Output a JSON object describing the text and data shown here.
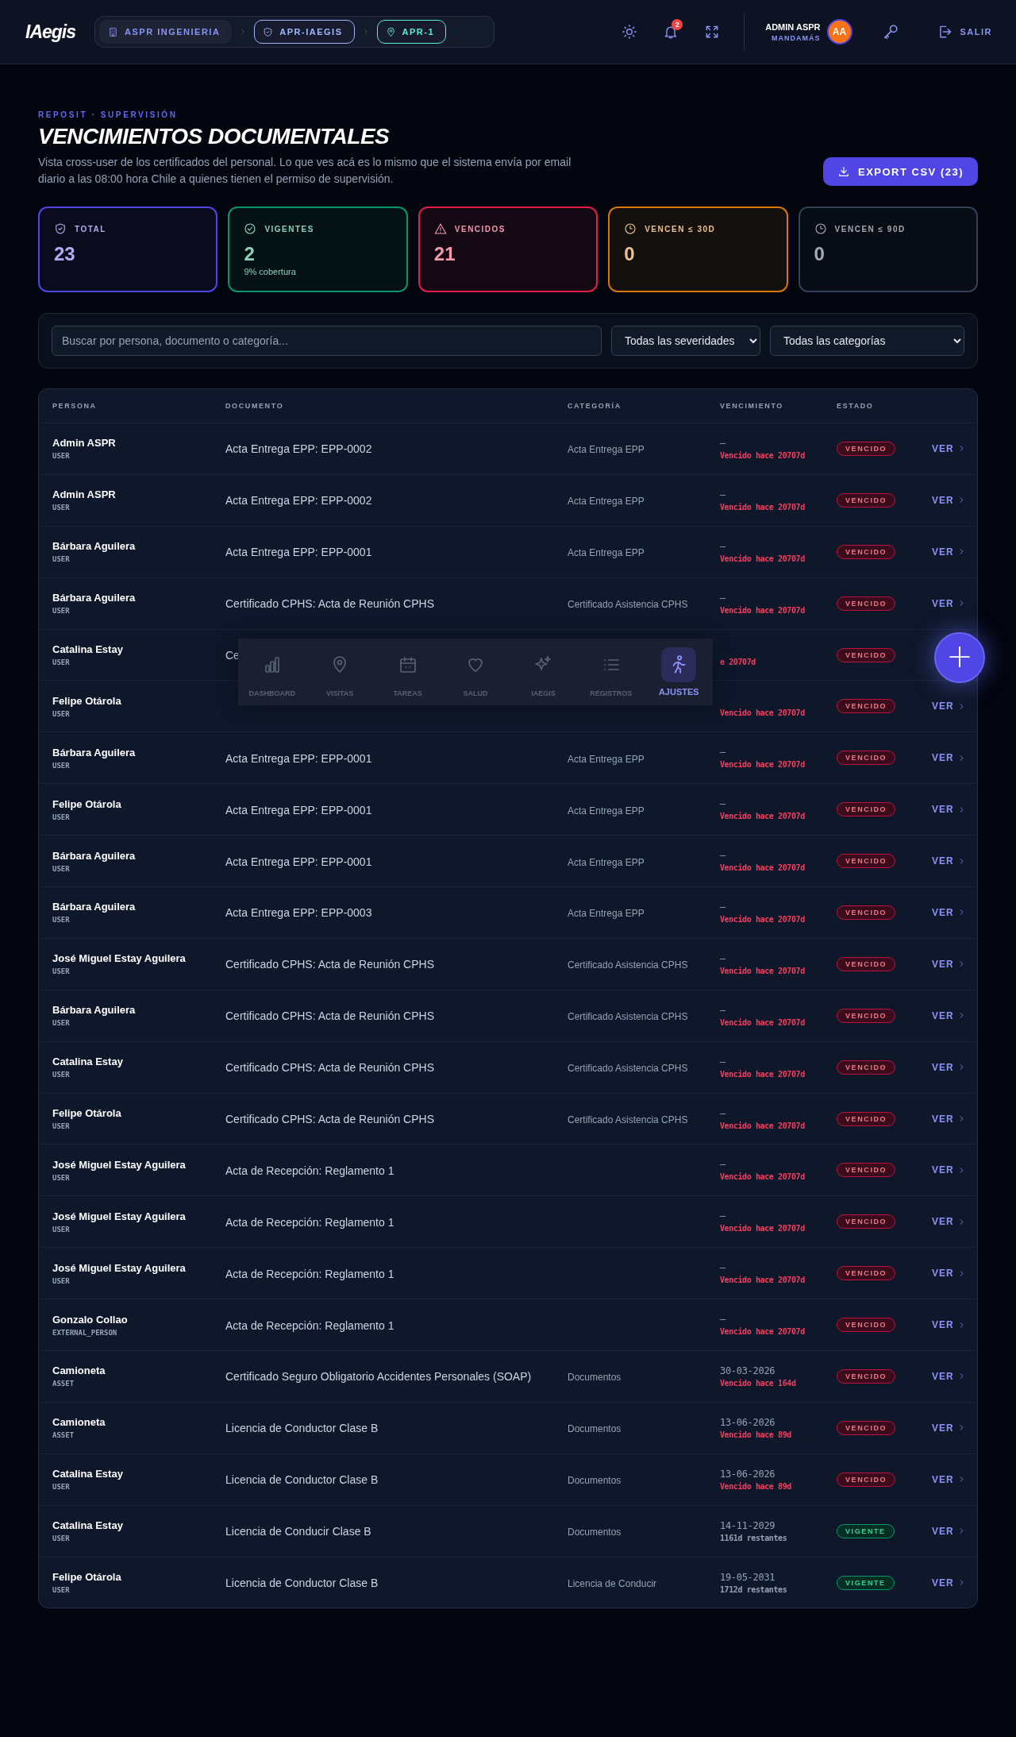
{
  "header": {
    "logo": "IAegis",
    "breadcrumbs": [
      {
        "label": "ASPR INGENIERIA",
        "color": "#1e2433"
      },
      {
        "label": "APR-IAEGIS",
        "color": "#a5b4fc"
      },
      {
        "label": "APR-1",
        "color": "#5eead4"
      }
    ],
    "notifications": "2",
    "user_name": "ADMIN ASPR",
    "user_role": "MANDAMÁS",
    "avatar": "AA",
    "logout": "SALIR"
  },
  "intro": {
    "eyebrow": "REPOSIT · SUPERVISIÓN",
    "title": "VENCIMIENTOS DOCUMENTALES",
    "description": "Vista cross-user de los certificados del personal. Lo que ves acá es lo mismo que el sistema envía por email diario a las 08:00 hora Chile a quienes tienen el permiso de supervisión.",
    "export_button": "EXPORT CSV (23)"
  },
  "stats": [
    {
      "label": "TOTAL",
      "value": "23",
      "color": "#4f46e5"
    },
    {
      "label": "VIGENTES",
      "value": "2",
      "sub": "9% cobertura",
      "color": "#059669"
    },
    {
      "label": "VENCIDOS",
      "value": "21",
      "color": "#e11d48"
    },
    {
      "label": "VENCEN ≤ 30D",
      "value": "0",
      "color": "#d97706"
    },
    {
      "label": "VENCEN ≤ 90D",
      "value": "0",
      "color": "#334155"
    }
  ],
  "filters": {
    "search": {
      "placeholder": "Buscar por persona, documento o categoría..."
    },
    "severity": "Todas las severidades",
    "category": "Todas las categorías"
  },
  "table": {
    "columns": [
      "PERSONA",
      "DOCUMENTO",
      "CATEGORÍA",
      "VENCIMIENTO",
      "ESTADO"
    ],
    "rows": [
      {
        "name": "Admin ASPR",
        "role": "USER",
        "document": "Acta Entrega EPP: EPP-0002",
        "category": "Acta Entrega EPP",
        "due": "—",
        "note": "Vencido hace 20707d",
        "status": "VENCIDO",
        "kind": "expired",
        "action": "VER"
      },
      {
        "name": "Admin ASPR",
        "role": "USER",
        "document": "Acta Entrega EPP: EPP-0002",
        "category": "Acta Entrega EPP",
        "due": "—",
        "note": "Vencido hace 20707d",
        "status": "VENCIDO",
        "kind": "expired",
        "action": "VER"
      },
      {
        "name": "Bárbara Aguilera",
        "role": "USER",
        "document": "Acta Entrega EPP: EPP-0001",
        "category": "Acta Entrega EPP",
        "due": "—",
        "note": "Vencido hace 20707d",
        "status": "VENCIDO",
        "kind": "expired",
        "action": "VER"
      },
      {
        "name": "Bárbara Aguilera",
        "role": "USER",
        "document": "Certificado CPHS: Acta de Reunión CPHS",
        "category": "Certificado Asistencia CPHS",
        "due": "—",
        "note": "Vencido hace 20707d",
        "status": "VENCIDO",
        "kind": "expired",
        "action": "VER"
      },
      {
        "name": "Catalina Estay",
        "role": "USER",
        "document": "Ce",
        "note": "e 20707d",
        "status": "VENCIDO",
        "kind": "expired"
      },
      {
        "name": "Felipe Otárola",
        "role": "USER",
        "note": "Vencido hace 20707d",
        "status": "VENCIDO",
        "kind": "expired",
        "action": "VER"
      },
      {
        "name": "Bárbara Aguilera",
        "role": "USER",
        "document": "Acta Entrega EPP: EPP-0001",
        "category": "Acta Entrega EPP",
        "due": "—",
        "note": "Vencido hace 20707d",
        "status": "VENCIDO",
        "kind": "expired",
        "action": "VER"
      },
      {
        "name": "Felipe Otárola",
        "role": "USER",
        "document": "Acta Entrega EPP: EPP-0001",
        "category": "Acta Entrega EPP",
        "due": "—",
        "note": "Vencido hace 20707d",
        "status": "VENCIDO",
        "kind": "expired",
        "action": "VER"
      },
      {
        "name": "Bárbara Aguilera",
        "role": "USER",
        "document": "Acta Entrega EPP: EPP-0001",
        "category": "Acta Entrega EPP",
        "due": "—",
        "note": "Vencido hace 20707d",
        "status": "VENCIDO",
        "kind": "expired",
        "action": "VER"
      },
      {
        "name": "Bárbara Aguilera",
        "role": "USER",
        "document": "Acta Entrega EPP: EPP-0003",
        "category": "Acta Entrega EPP",
        "due": "—",
        "note": "Vencido hace 20707d",
        "status": "VENCIDO",
        "kind": "expired",
        "action": "VER"
      },
      {
        "name": "José Miguel Estay Aguilera",
        "role": "USER",
        "document": "Certificado CPHS: Acta de Reunión CPHS",
        "category": "Certificado Asistencia CPHS",
        "due": "—",
        "note": "Vencido hace 20707d",
        "status": "VENCIDO",
        "kind": "expired",
        "action": "VER"
      },
      {
        "name": "Bárbara Aguilera",
        "role": "USER",
        "document": "Certificado CPHS: Acta de Reunión CPHS",
        "category": "Certificado Asistencia CPHS",
        "due": "—",
        "note": "Vencido hace 20707d",
        "status": "VENCIDO",
        "kind": "expired",
        "action": "VER"
      },
      {
        "name": "Catalina Estay",
        "role": "USER",
        "document": "Certificado CPHS: Acta de Reunión CPHS",
        "category": "Certificado Asistencia CPHS",
        "due": "—",
        "note": "Vencido hace 20707d",
        "status": "VENCIDO",
        "kind": "expired",
        "action": "VER"
      },
      {
        "name": "Felipe Otárola",
        "role": "USER",
        "document": "Certificado CPHS: Acta de Reunión CPHS",
        "category": "Certificado Asistencia CPHS",
        "due": "—",
        "note": "Vencido hace 20707d",
        "status": "VENCIDO",
        "kind": "expired",
        "action": "VER"
      },
      {
        "name": "José Miguel Estay Aguilera",
        "role": "USER",
        "document": "Acta de Recepción: Reglamento 1",
        "due": "—",
        "note": "Vencido hace 20707d",
        "status": "VENCIDO",
        "kind": "expired",
        "action": "VER"
      },
      {
        "name": "José Miguel Estay Aguilera",
        "role": "USER",
        "document": "Acta de Recepción: Reglamento 1",
        "due": "—",
        "note": "Vencido hace 20707d",
        "status": "VENCIDO",
        "kind": "expired",
        "action": "VER"
      },
      {
        "name": "José Miguel Estay Aguilera",
        "role": "USER",
        "document": "Acta de Recepción: Reglamento 1",
        "due": "—",
        "note": "Vencido hace 20707d",
        "status": "VENCIDO",
        "kind": "expired",
        "action": "VER"
      },
      {
        "name": "Gonzalo Collao",
        "role": "EXTERNAL_PERSON",
        "document": "Acta de Recepción: Reglamento 1",
        "due": "—",
        "note": "Vencido hace 20707d",
        "status": "VENCIDO",
        "kind": "expired",
        "action": "VER"
      },
      {
        "name": "Camioneta",
        "role": "ASSET",
        "document": "Certificado Seguro Obligatorio Accidentes Personales (SOAP)",
        "category": "Documentos",
        "due": "30-03-2026",
        "note": "Vencido hace 164d",
        "status": "VENCIDO",
        "kind": "expired",
        "action": "VER"
      },
      {
        "name": "Camioneta",
        "role": "ASSET",
        "document": "Licencia de Conductor Clase B",
        "category": "Documentos",
        "due": "13-06-2026",
        "note": "Vencido hace 89d",
        "status": "VENCIDO",
        "kind": "expired",
        "action": "VER"
      },
      {
        "name": "Catalina Estay",
        "role": "USER",
        "document": "Licencia de Conductor Clase B",
        "category": "Documentos",
        "due": "13-06-2026",
        "note": "Vencido hace 89d",
        "status": "VENCIDO",
        "kind": "expired",
        "action": "VER"
      },
      {
        "name": "Catalina Estay",
        "role": "USER",
        "document": "Licencia de Conducir Clase B",
        "category": "Documentos",
        "due": "14-11-2029",
        "note": "1161d restantes",
        "status": "VIGENTE",
        "kind": "valid",
        "action": "VER"
      },
      {
        "name": "Felipe Otárola",
        "role": "USER",
        "document": "Licencia de Conductor Clase B",
        "category": "Licencia de Conducir",
        "due": "19-05-2031",
        "note": "1712d restantes",
        "status": "VIGENTE",
        "kind": "valid",
        "action": "VER"
      }
    ]
  },
  "bottom_nav": [
    {
      "label": "DASHBOARD",
      "selected": false
    },
    {
      "label": "VISITAS",
      "selected": false
    },
    {
      "label": "TAREAS",
      "selected": false
    },
    {
      "label": "SALUD",
      "selected": false
    },
    {
      "label": "IAEGIS",
      "selected": false
    },
    {
      "label": "REGISTROS",
      "selected": false
    },
    {
      "label": "AJUSTES",
      "selected": true
    }
  ],
  "fab": "+"
}
